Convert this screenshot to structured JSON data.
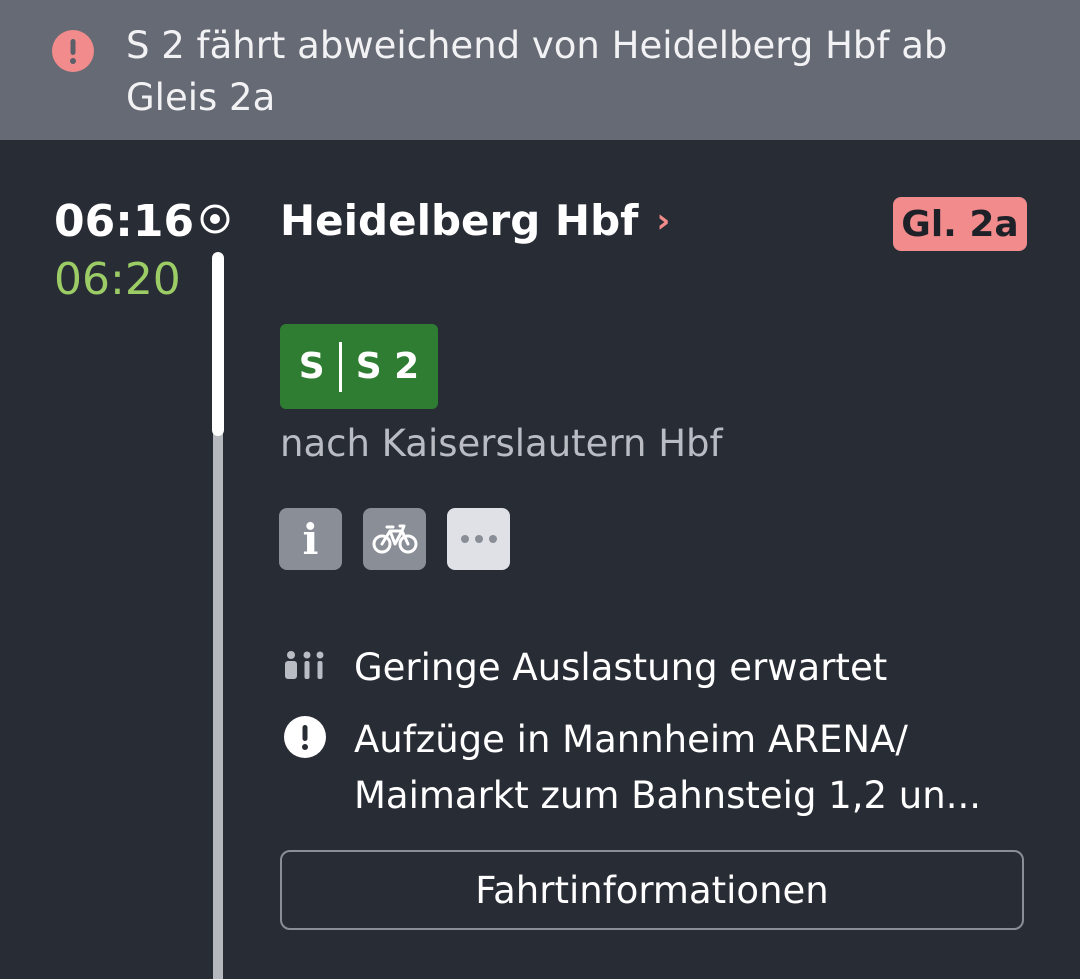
{
  "banner": {
    "icon": "alert-icon",
    "text": "S 2 fährt abweichend von Heidelberg Hbf ab Gleis 2a",
    "color": "#f28b8b"
  },
  "stop": {
    "planned_time": "06:16",
    "actual_time": "06:20",
    "station": "Heidelberg Hbf",
    "chevron": "›",
    "platform": "Gl. 2a"
  },
  "train": {
    "product": "S",
    "line": "S 2",
    "direction": "nach Kaiserslautern Hbf",
    "badge_color": "#2e7d32"
  },
  "attributes": [
    {
      "icon": "info-icon",
      "glyph": "i"
    },
    {
      "icon": "bicycle-icon"
    },
    {
      "icon": "more-icon"
    }
  ],
  "messages": {
    "occupancy": "Geringe Auslastung erwartet",
    "elevator": "Aufzüge in Mannheim ARENA/ Maimarkt zum Bahnsteig 1,2 un..."
  },
  "trip_button": "Fahrtinformationen"
}
